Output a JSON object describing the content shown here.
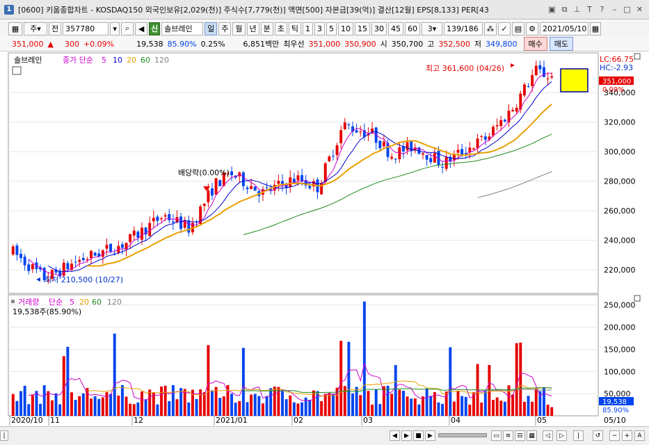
{
  "window": {
    "number": "1",
    "title": "[0600] 키움종합차트 - KOSDAQ150 외국인보유[2,029(천)] 주식수[7,779(천)] 액면[500] 자본금[39(억)] 결산[12월] EPS[8,133] PER[43"
  },
  "toolbar": {
    "period_type": "주",
    "prev_label": "전",
    "stock_code": "357780",
    "stock_tag": "신",
    "stock_name": "솔브레인",
    "periods": [
      "일",
      "주",
      "월",
      "년",
      "분",
      "초",
      "틱"
    ],
    "minutes": [
      "1",
      "3",
      "5",
      "10",
      "15",
      "30",
      "45",
      "60"
    ],
    "interval": "3",
    "page_count": "139/186",
    "date": "2021/05/10"
  },
  "quote": {
    "price": "351,000",
    "change_arrow": "▲",
    "change": "300",
    "change_pct": "+0.09%",
    "volume": "19,538",
    "volume_ratio": "85.90%",
    "turnover": "0.25%",
    "trade_value": "6,851백만",
    "best_bid_label": "최우선",
    "best_ask": "351,000",
    "best_bid": "350,900",
    "open_label": "시",
    "open": "350,700",
    "high_label": "고",
    "high": "352,500",
    "low_label": "저",
    "low": "349,800",
    "buy_label": "매수",
    "sell_label": "매도"
  },
  "price_panel": {
    "stock_label": "솔브레인",
    "ma_title": "종가 단순",
    "ma_periods": [
      "5",
      "10",
      "20",
      "60",
      "120"
    ],
    "ma_colors": [
      "#cc00cc",
      "#0000cc",
      "#e8a000",
      "#1e8a1e",
      "#808080"
    ],
    "high_annotation": "최고 361,600 (04/26)",
    "low_annotation": "최저 210,500 (10/27)",
    "dividend_label": "배당락(0.00%)",
    "lc": "LC:66.75",
    "hc": "HC:-2.93",
    "current_price": "351,000",
    "current_pct": "0.09%",
    "up_color": "#e60000",
    "down_color": "#0044ee"
  },
  "volume_panel": {
    "title": "거래량",
    "ma_title": "단순",
    "ma_periods": [
      "5",
      "20",
      "60",
      "120"
    ],
    "current": "19,538주(85.90%)",
    "current_value": "19,538",
    "current_pct": "85.90%"
  },
  "x_axis": {
    "labels": [
      "2020/10",
      "11",
      "12",
      "2021/01",
      "02",
      "03",
      "04",
      "05"
    ],
    "right_label": "05/10"
  },
  "chart_data": {
    "type": "candlestick",
    "y_axis_price": [
      "220,000",
      "240,000",
      "260,000",
      "280,000",
      "300,000",
      "320,000",
      "340,000"
    ],
    "y_axis_volume": [
      "50,000",
      "100,000",
      "150,000",
      "200,000",
      "250,000"
    ],
    "price_range": [
      205000,
      365000
    ],
    "volume_range": [
      0,
      270000
    ],
    "series_close_start": 228000,
    "series_close_end": 351000,
    "high": 361600,
    "low": 210500
  }
}
